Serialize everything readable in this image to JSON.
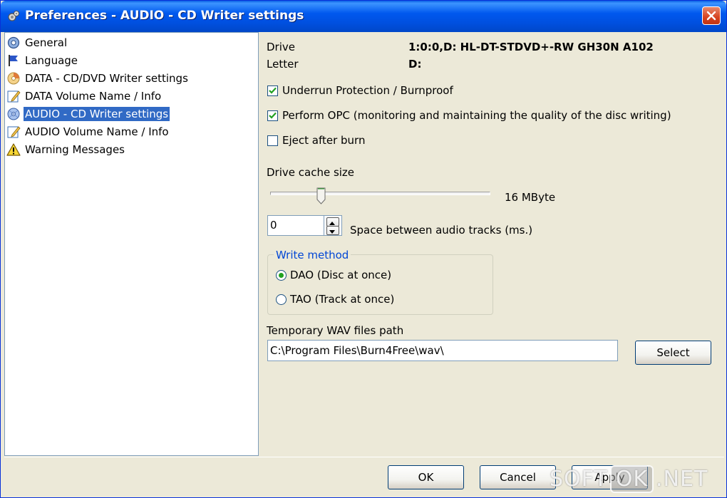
{
  "window": {
    "title": "Preferences - AUDIO - CD Writer settings"
  },
  "tree": {
    "items": [
      {
        "label": "General",
        "icon": "gear-icon"
      },
      {
        "label": "Language",
        "icon": "flag-icon"
      },
      {
        "label": "DATA - CD/DVD Writer settings",
        "icon": "cd-icon"
      },
      {
        "label": "DATA Volume Name / Info",
        "icon": "edit-icon"
      },
      {
        "label": "AUDIO - CD Writer settings",
        "icon": "audio-cd-icon",
        "selected": true
      },
      {
        "label": "AUDIO Volume Name / Info",
        "icon": "edit-icon"
      },
      {
        "label": "Warning Messages",
        "icon": "warning-icon"
      }
    ]
  },
  "drive": {
    "drive_label": "Drive",
    "drive_value": "1:0:0,D: HL-DT-STDVD+-RW GH30N   A102",
    "letter_label": "Letter",
    "letter_value": "D:"
  },
  "options": {
    "underrun": {
      "label": "Underrun Protection / Burnproof",
      "checked": true
    },
    "opc": {
      "label": "Perform OPC (monitoring and maintaining the quality of the disc writing)",
      "checked": true
    },
    "eject": {
      "label": "Eject after burn",
      "checked": false
    }
  },
  "cache": {
    "label": "Drive cache size",
    "value_text": "16 MByte",
    "slider_fraction": 0.22
  },
  "gap": {
    "value": "0",
    "label": "Space between audio tracks (ms.)"
  },
  "write_method": {
    "legend": "Write method",
    "dao": {
      "label": "DAO (Disc at once)",
      "selected": true
    },
    "tao": {
      "label": "TAO (Track at once)",
      "selected": false
    }
  },
  "temp_path": {
    "label": "Temporary WAV files path",
    "value": "C:\\Program Files\\Burn4Free\\wav\\",
    "select_label": "Select"
  },
  "footer": {
    "ok_label": "OK",
    "cancel_label": "Cancel",
    "apply_label": "Apply"
  },
  "watermark": {
    "part1": "SOFT",
    "part2": "OK",
    "part3": ".NET"
  },
  "colors": {
    "selection": "#316ac5",
    "title_blue": "#0058ee",
    "group_legend": "#0046d5"
  }
}
